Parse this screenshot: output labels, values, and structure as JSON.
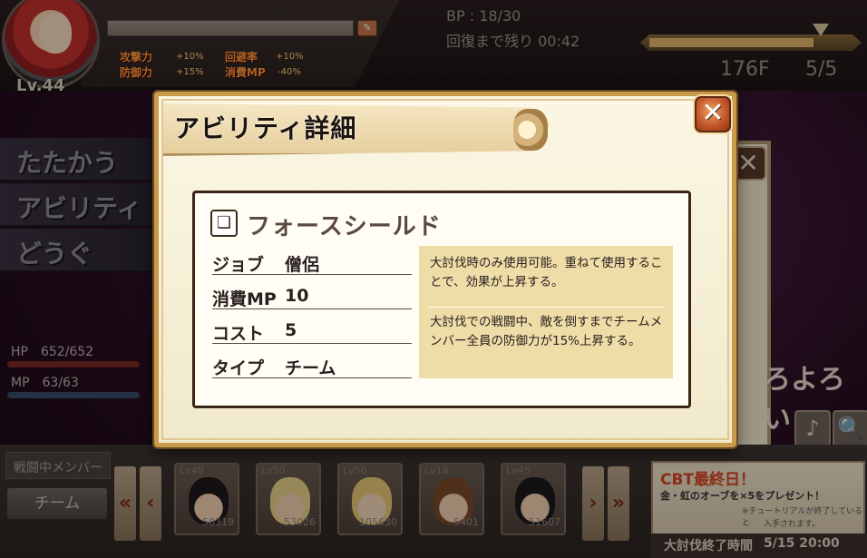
{
  "player": {
    "level": "Lv.44",
    "stats": [
      {
        "label": "攻撃力",
        "value": "+10%"
      },
      {
        "label": "防御力",
        "value": "+15%"
      },
      {
        "label": "回避率",
        "value": "+10%"
      },
      {
        "label": "消費MP",
        "value": "-40%"
      }
    ],
    "hp": "HP　652/652",
    "mp": "MP　63/63",
    "hp_fraction": 1.0,
    "mp_fraction": 1.0
  },
  "status": {
    "bp": "BP : 18/30",
    "recover": "回復まで残り 00:42",
    "floor": "176F",
    "floor_page": "5/5",
    "floor_progress": 0.81
  },
  "menu": [
    "たたかう",
    "アビリティ",
    "どうぐ"
  ],
  "background": {
    "close_glyph": "✕",
    "speech_text": "ろよろい",
    "icons": [
      "♪",
      "🔍"
    ]
  },
  "bottom": {
    "battle_tab": "戦闘中メンバー",
    "team_button": "チーム",
    "members": [
      {
        "level": "Lv49",
        "power": "58319",
        "hair": "#1e1a1c",
        "skin": "#f1d0b0"
      },
      {
        "level": "Lv50",
        "power": "53026",
        "hair": "#e8d28a",
        "skin": "#f1d0b0"
      },
      {
        "level": "Lv56",
        "power": "105630",
        "hair": "#e8c878",
        "skin": "#f3d6b8"
      },
      {
        "level": "Lv18",
        "power": "5401",
        "hair": "#7a4a28",
        "skin": "#f1d0b0"
      },
      {
        "level": "Lv45",
        "power": "51607",
        "hair": "#1e1a1c",
        "skin": "#f1d0b0"
      }
    ],
    "event_title": "CBT最終日！",
    "event_line1": "金・虹のオーブを×5をプレゼント！",
    "event_line2": "※チュートリアルが終了していると",
    "event_line3": "入手されます。",
    "end_label": "大討伐終了時間",
    "end_time": "5/15 20:00"
  },
  "modal": {
    "title": "アビリティ詳細",
    "close_glyph": "✕",
    "skill_name": "フォースシールド",
    "rows": [
      {
        "key": "ジョブ",
        "value": "僧侶"
      },
      {
        "key": "消費MP",
        "value": "10"
      },
      {
        "key": "コスト",
        "value": "5"
      },
      {
        "key": "タイプ",
        "value": "チーム"
      }
    ],
    "desc1": "大討伐時のみ使用可能。重ねて使用することで、効果が上昇する。",
    "desc2": "大討伐での戦闘中、敵を倒すまでチームメンバー全員の防御力が15%上昇する。"
  }
}
